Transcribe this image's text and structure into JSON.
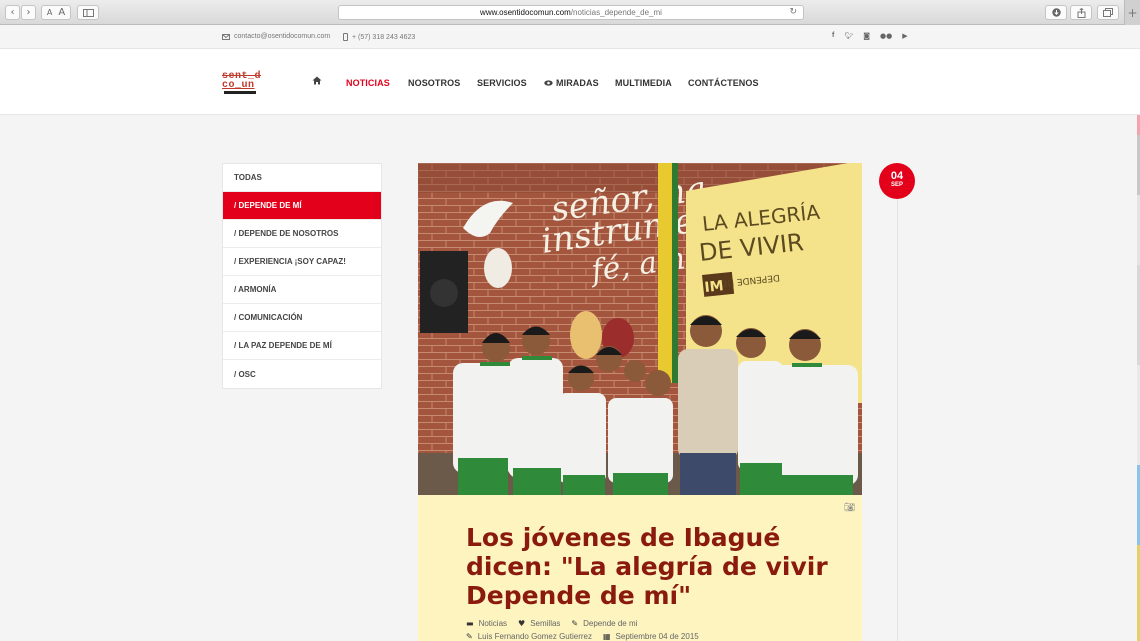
{
  "browser": {
    "url_domain": "www.osentidocomun.com",
    "url_path": "/noticias_depende_de_mi",
    "font_small": "A",
    "font_large": "A"
  },
  "topbar": {
    "email": "contacto@osentidocomun.com",
    "phone": "+ (57) 318 243 4623",
    "social_icons": [
      "facebook-icon",
      "twitter-icon",
      "instagram-icon",
      "flickr-icon",
      "youtube-icon"
    ]
  },
  "logo": {
    "line1": "sent_d",
    "line2": "co_un"
  },
  "nav": {
    "items": [
      "NOTICIAS",
      "NOSOTROS",
      "SERVICIOS",
      "MIRADAS",
      "MULTIMEDIA",
      "CONTÁCTENOS"
    ],
    "active": "NOTICIAS"
  },
  "sidebar": {
    "items": [
      "TODAS",
      "/ DEPENDE DE MÍ",
      "/ DEPENDE DE NOSOTROS",
      "/ EXPERIENCIA ¡SOY CAPAZ!",
      "/ ARMONÍA",
      "/ COMUNICACIÓN",
      "/ LA PAZ DEPENDE DE MÍ",
      "/ OSC"
    ],
    "active_index": 1
  },
  "post": {
    "date_day": "04",
    "date_month": "SEP",
    "title": "Los jóvenes de Ibagué dicen: \"La alegría de vivir Depende de mí\"",
    "category": "Noticias",
    "tag": "Semillas",
    "subcategory": "Depende de mi",
    "author": "Luis Fernando Gomez Gutierrez",
    "published": "Septiembre 04 de 2015",
    "hero_wall_text": [
      "señor, ha",
      "instrume",
      "fé, amor"
    ],
    "hero_banner": [
      "LA ALEGRÍA",
      "DE VIVIR",
      "IM",
      "DEPENDE DE"
    ]
  },
  "colors": {
    "accent": "#e2001a",
    "title": "#8a1a0e",
    "card_bg": "#fdf4c0"
  }
}
